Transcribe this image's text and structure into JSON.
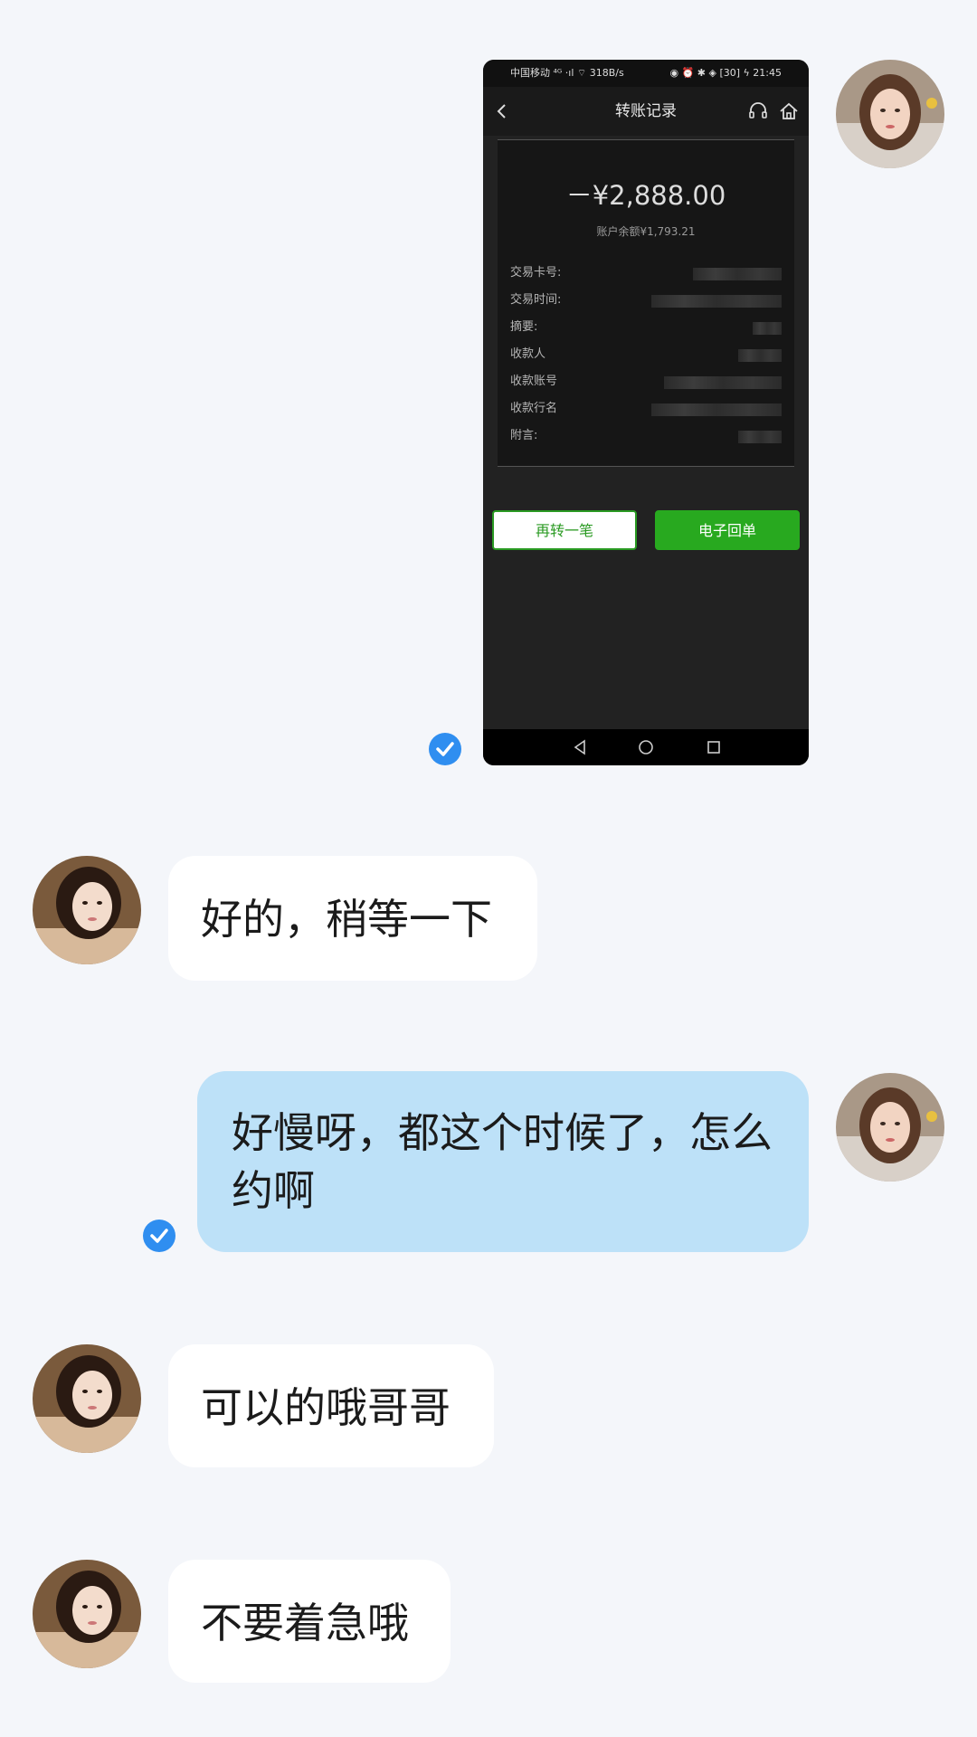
{
  "screenshot_message": {
    "status_left": "中国移动 ⁴ᴳ ·ıl ⌔ 318B/s",
    "status_right": "◉ ⏰ ✱ ◈ [30] ϟ 21:45",
    "title": "转账记录",
    "amount": "－¥2,888.00",
    "balance": "账户余额¥1,793.21",
    "fields": [
      {
        "label": "交易卡号:"
      },
      {
        "label": "交易时间:"
      },
      {
        "label": "摘要:"
      },
      {
        "label": "收款人"
      },
      {
        "label": "收款账号"
      },
      {
        "label": "收款行名"
      },
      {
        "label": "附言:"
      }
    ],
    "btn_again": "再转一笔",
    "btn_receipt": "电子回单",
    "colors": {
      "accent_green": "#28a91f",
      "dark_bg": "#222222"
    }
  },
  "messages": [
    {
      "side": "in",
      "text": "好的，稍等一下"
    },
    {
      "side": "out",
      "text": "好慢呀，都这个时候了，怎么约啊"
    },
    {
      "side": "in",
      "text": "可以的哦哥哥"
    },
    {
      "side": "in",
      "text": "不要着急哦"
    }
  ],
  "colors": {
    "page_bg": "#f4f6fa",
    "incoming_bubble": "#ffffff",
    "outgoing_bubble": "#bde1f8",
    "read_check": "#2f8ef0"
  }
}
